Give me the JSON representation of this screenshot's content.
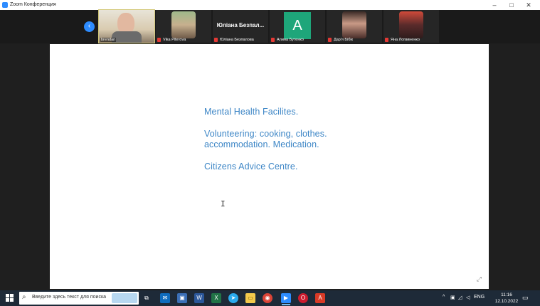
{
  "window": {
    "title": "Zoom Конференция",
    "controls": {
      "minimize": "–",
      "maximize": "□",
      "close": "✕"
    }
  },
  "gallery": {
    "back_icon": "‹",
    "participants": [
      {
        "name": "brendan",
        "type": "video",
        "active": true
      },
      {
        "name": "Vika Piterova",
        "type": "video",
        "muted": true
      },
      {
        "name": "Юліана Безпалова",
        "display_title": "Юліана Безпал...",
        "type": "name",
        "muted": true
      },
      {
        "name": "Алина Бутенко",
        "initial": "A",
        "type": "avatar",
        "muted": true
      },
      {
        "name": "Дар'я Бібік",
        "type": "video",
        "muted": true
      },
      {
        "name": "Яна Логвиненко",
        "type": "video",
        "muted": true
      }
    ]
  },
  "slide": {
    "lines": [
      "Mental Health Facilites.",
      "Volunteering: cooking, clothes.",
      "accommodation. Medication.",
      "Citizens Advice Centre."
    ],
    "cursor_icon": "I",
    "corner_icon": "⤢"
  },
  "taskbar": {
    "start_icon": "windows-icon",
    "search_placeholder": "Введите здесь текст для поиска",
    "apps": [
      {
        "name": "task-view-icon",
        "glyph": "⧉",
        "color": "#1e2a38"
      },
      {
        "name": "mail-icon",
        "glyph": "✉",
        "color": "#0f6cbd"
      },
      {
        "name": "save-icon",
        "glyph": "▣",
        "color": "#3b6fb6"
      },
      {
        "name": "word-icon",
        "glyph": "W",
        "color": "#2b579a"
      },
      {
        "name": "excel-icon",
        "glyph": "X",
        "color": "#217346"
      },
      {
        "name": "telegram-icon",
        "glyph": "➤",
        "color": "#2aabee"
      },
      {
        "name": "file-explorer-icon",
        "glyph": "▭",
        "color": "#f2c94c"
      },
      {
        "name": "chrome-icon",
        "glyph": "◉",
        "color": "#db4437"
      },
      {
        "name": "zoom-icon",
        "glyph": "▶",
        "color": "#2d8cff",
        "active": true
      },
      {
        "name": "opera-icon",
        "glyph": "O",
        "color": "#cc1b2e"
      },
      {
        "name": "acrobat-icon",
        "glyph": "A",
        "color": "#d93a26"
      }
    ],
    "tray": {
      "chevron": "^",
      "language": "ENG"
    },
    "time": "11:16",
    "date": "12.10.2022"
  }
}
